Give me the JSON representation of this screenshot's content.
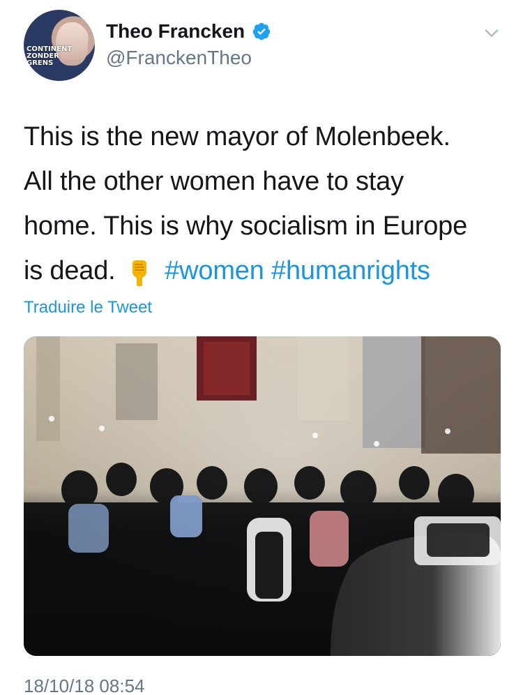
{
  "author": {
    "display_name": "Theo Francken",
    "handle": "@FranckenTheo",
    "avatar_caption": "CONTINENT\nZONDER\nGRENS"
  },
  "tweet": {
    "line_1": "This is the new mayor of Molenbeek.",
    "line_2": "All the other women have to stay",
    "line_3": "home. This is why socialism in Europe",
    "line_4_prefix": "is dead.",
    "emoji_icon": "pointing-down-hand-icon",
    "hashtags": [
      "#women",
      "#humanrights"
    ]
  },
  "actions": {
    "translate_label": "Traduire le Tweet"
  },
  "meta": {
    "timestamp": "18/10/18 08:54"
  },
  "colors": {
    "link": "#1b95e0",
    "text": "#14171a",
    "muted": "#657786",
    "verified": "#1da1f2"
  }
}
